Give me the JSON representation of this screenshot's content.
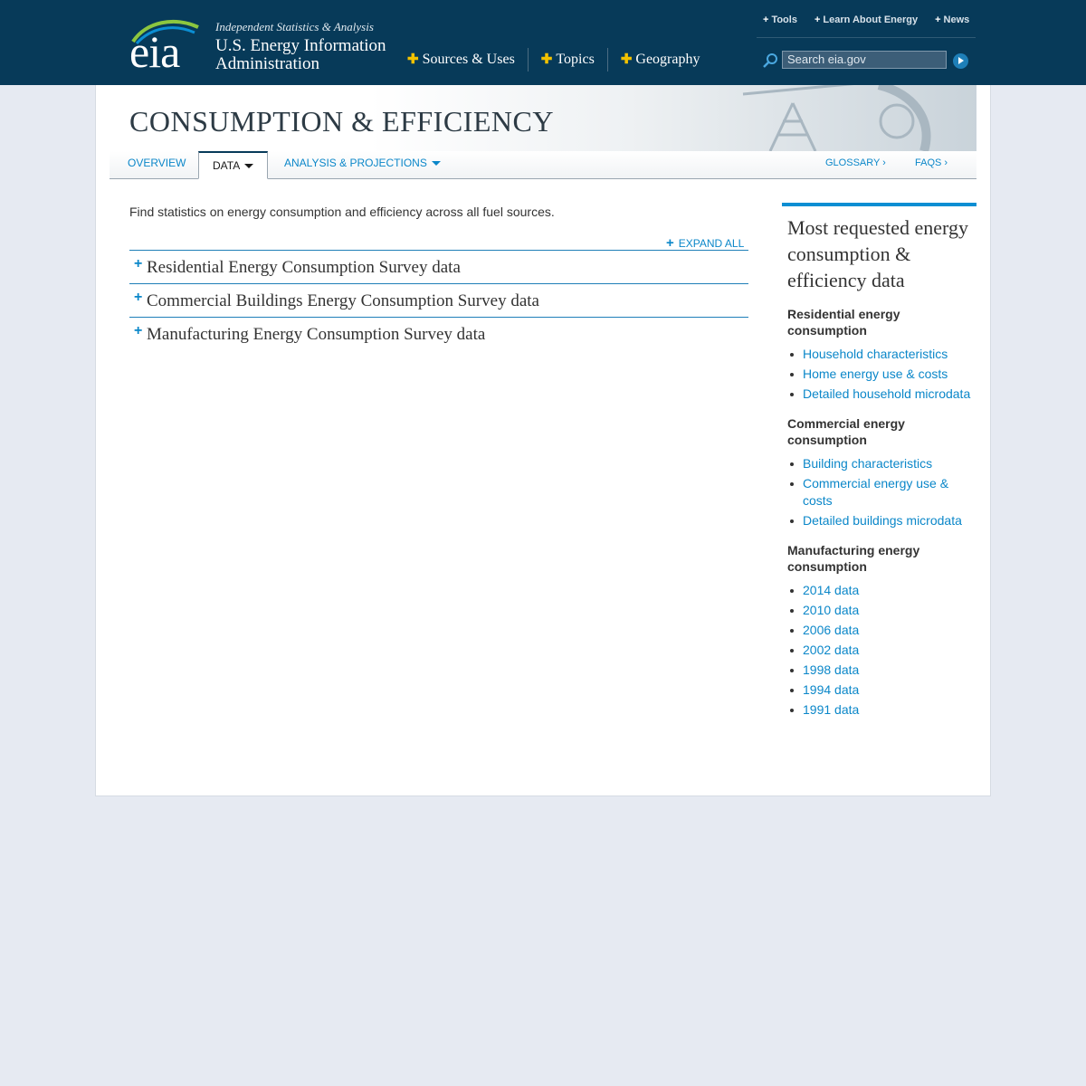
{
  "header": {
    "logo_text": "eia",
    "tagline": "Independent Statistics & Analysis",
    "agency_name": "U.S. Energy Information Administration",
    "main_nav": [
      {
        "label": "Sources & Uses"
      },
      {
        "label": "Topics"
      },
      {
        "label": "Geography"
      }
    ],
    "utility_nav": [
      {
        "label": "Tools"
      },
      {
        "label": "Learn About Energy"
      },
      {
        "label": "News"
      }
    ],
    "search": {
      "placeholder": "Search eia.gov"
    },
    "colors": {
      "bar": "#073a59",
      "plus": "#f2c200"
    }
  },
  "page": {
    "title": "CONSUMPTION & EFFICIENCY",
    "tabs": [
      {
        "label": "OVERVIEW",
        "active": false
      },
      {
        "label": "DATA",
        "active": true
      },
      {
        "label": "ANALYSIS & PROJECTIONS",
        "active": false
      }
    ],
    "right_links": [
      "GLOSSARY ›",
      "FAQS ›"
    ],
    "intro": "Find statistics on energy consumption and efficiency across all fuel sources.",
    "expand_all": "EXPAND ALL",
    "accordion": [
      {
        "title": "Residential Energy Consumption Survey data"
      },
      {
        "title": "Commercial Buildings Energy Consumption Survey data"
      },
      {
        "title": "Manufacturing Energy Consumption Survey data"
      }
    ]
  },
  "sidebar": {
    "title": "Most requested energy consumption & efficiency data",
    "sections": [
      {
        "heading": "Residential energy consumption",
        "links": [
          "Household characteristics",
          "Home energy use & costs",
          "Detailed household microdata"
        ]
      },
      {
        "heading": "Commercial energy consumption",
        "links": [
          "Building characteristics",
          "Commercial energy use & costs",
          "Detailed buildings microdata"
        ]
      },
      {
        "heading": "Manufacturing energy consumption",
        "links": [
          "2014 data",
          "2010 data",
          "2006 data",
          "2002 data",
          "1998 data",
          "1994 data",
          "1991 data"
        ]
      }
    ],
    "accent_color": "#0b8ed3"
  }
}
